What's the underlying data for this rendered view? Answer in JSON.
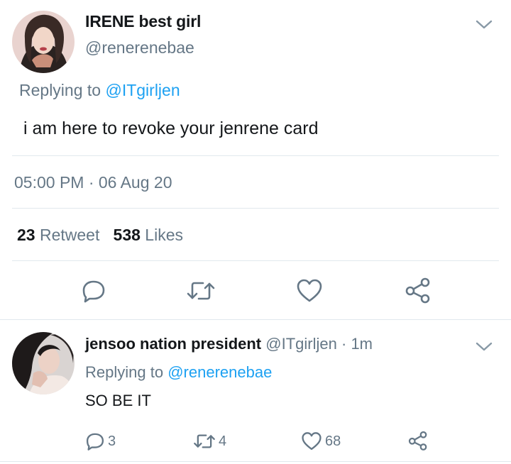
{
  "main_tweet": {
    "display_name": "IRENE best girl",
    "handle": "@renerenebae",
    "replying_prefix": "Replying to",
    "replying_to": "@ITgirljen",
    "text": "i am here to revoke your jenrene card",
    "timestamp": "05:00 PM · 06 Aug 20",
    "retweet_count": "23",
    "retweet_label": "Retweet",
    "like_count": "538",
    "like_label": "Likes",
    "icons": {
      "reply": "reply-icon",
      "retweet": "retweet-icon",
      "like": "heart-icon",
      "share": "share-icon",
      "menu": "chevron-down-icon"
    }
  },
  "reply_tweet": {
    "display_name": "jensoo nation president",
    "handle": "@ITgirljen",
    "separator": "·",
    "time_ago": "1m",
    "replying_prefix": "Replying to",
    "replying_to": "@renerenebae",
    "text": "SO BE IT",
    "reply_count": "3",
    "retweet_count": "4",
    "like_count": "68"
  },
  "colors": {
    "text": "#14171a",
    "secondary": "#657786",
    "link": "#1da1f2",
    "divider": "#e1e8ed"
  }
}
